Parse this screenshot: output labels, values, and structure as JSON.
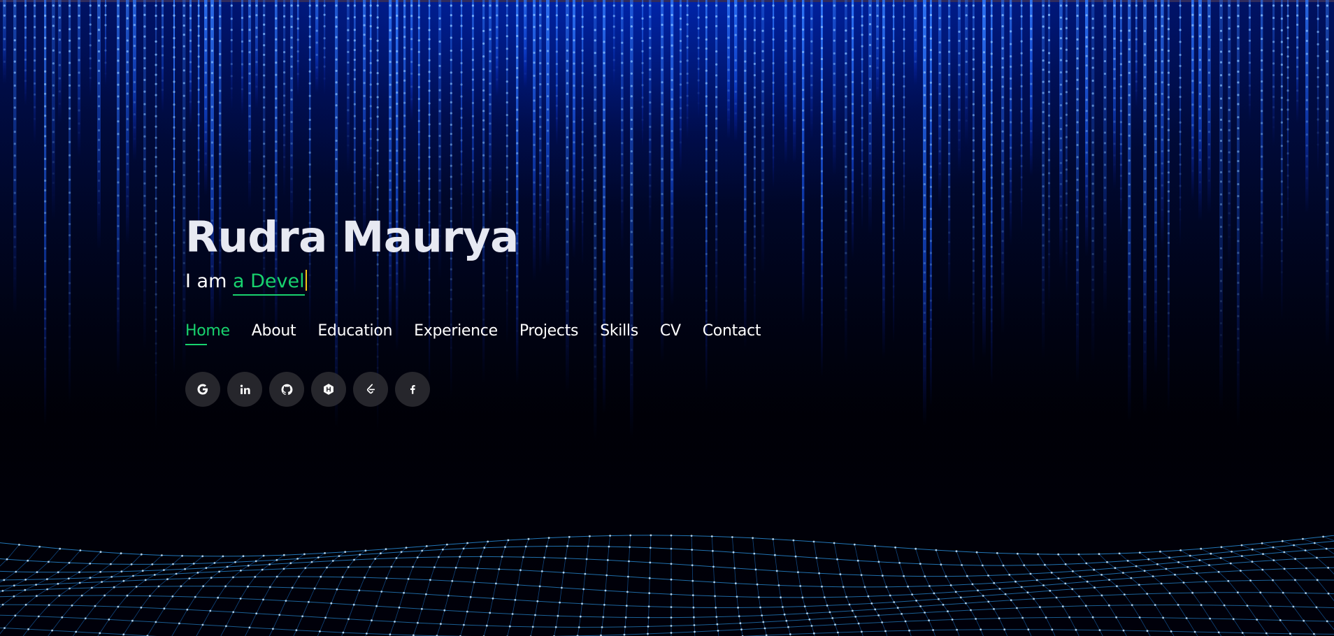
{
  "profile": {
    "name": "Rudra Maurya",
    "intro_prefix": "I am",
    "typed_text": "a Devel"
  },
  "nav": {
    "items": [
      {
        "label": "Home",
        "active": true
      },
      {
        "label": "About",
        "active": false
      },
      {
        "label": "Education",
        "active": false
      },
      {
        "label": "Experience",
        "active": false
      },
      {
        "label": "Projects",
        "active": false
      },
      {
        "label": "Skills",
        "active": false
      },
      {
        "label": "CV",
        "active": false
      },
      {
        "label": "Contact",
        "active": false
      }
    ]
  },
  "social": [
    {
      "icon": "google-icon"
    },
    {
      "icon": "linkedin-icon"
    },
    {
      "icon": "github-icon"
    },
    {
      "icon": "hackerrank-icon"
    },
    {
      "icon": "leetcode-icon"
    },
    {
      "icon": "facebook-icon"
    }
  ],
  "colors": {
    "accent": "#18d26e",
    "cursor": "#f3c614",
    "heading": "#e7e9f2",
    "rain": "#1a6bff",
    "grid": "#39b6ff"
  }
}
